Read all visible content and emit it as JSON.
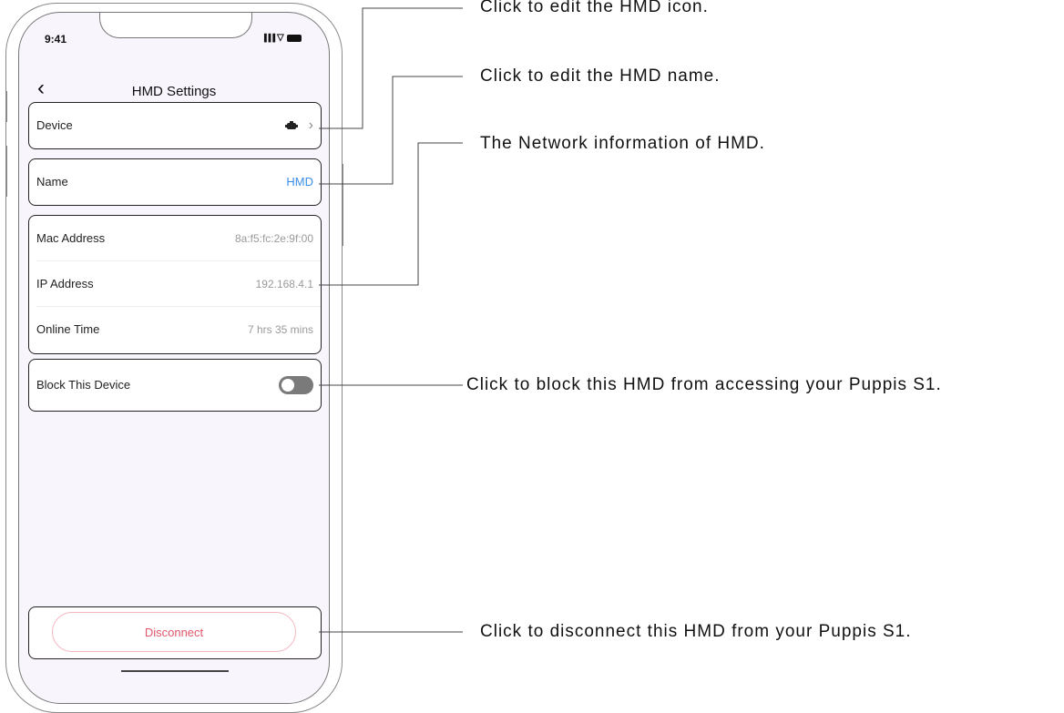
{
  "status_bar": {
    "time": "9:41",
    "signal": "▐▐▐",
    "wifi": "▽"
  },
  "nav": {
    "back_glyph": "‹",
    "title": "HMD Settings"
  },
  "device_row": {
    "label": "Device",
    "icon": "headset-icon",
    "chevron": "›"
  },
  "name_row": {
    "label": "Name",
    "value": "HMD"
  },
  "network": {
    "rows": [
      {
        "label": "Mac Address",
        "value": "8a:f5:fc:2e:9f:00"
      },
      {
        "label": "IP Address",
        "value": "192.168.4.1"
      },
      {
        "label": "Online Time",
        "value": "7 hrs 35 mins"
      }
    ]
  },
  "block_row": {
    "label": "Block This Device",
    "toggle_on": false
  },
  "disconnect": {
    "label": "Disconnect"
  },
  "callouts": {
    "icon": "Click to edit the HMD icon.",
    "name": "Click to edit the HMD name.",
    "network": "The Network information of HMD.",
    "block": "Click to block this HMD from accessing your Puppis S1.",
    "disconnect": "Click to disconnect this HMD from your Puppis S1."
  },
  "colors": {
    "accent_blue": "#3b8ee8",
    "danger": "#e0566a",
    "screen_bg": "#f8f5fc"
  }
}
